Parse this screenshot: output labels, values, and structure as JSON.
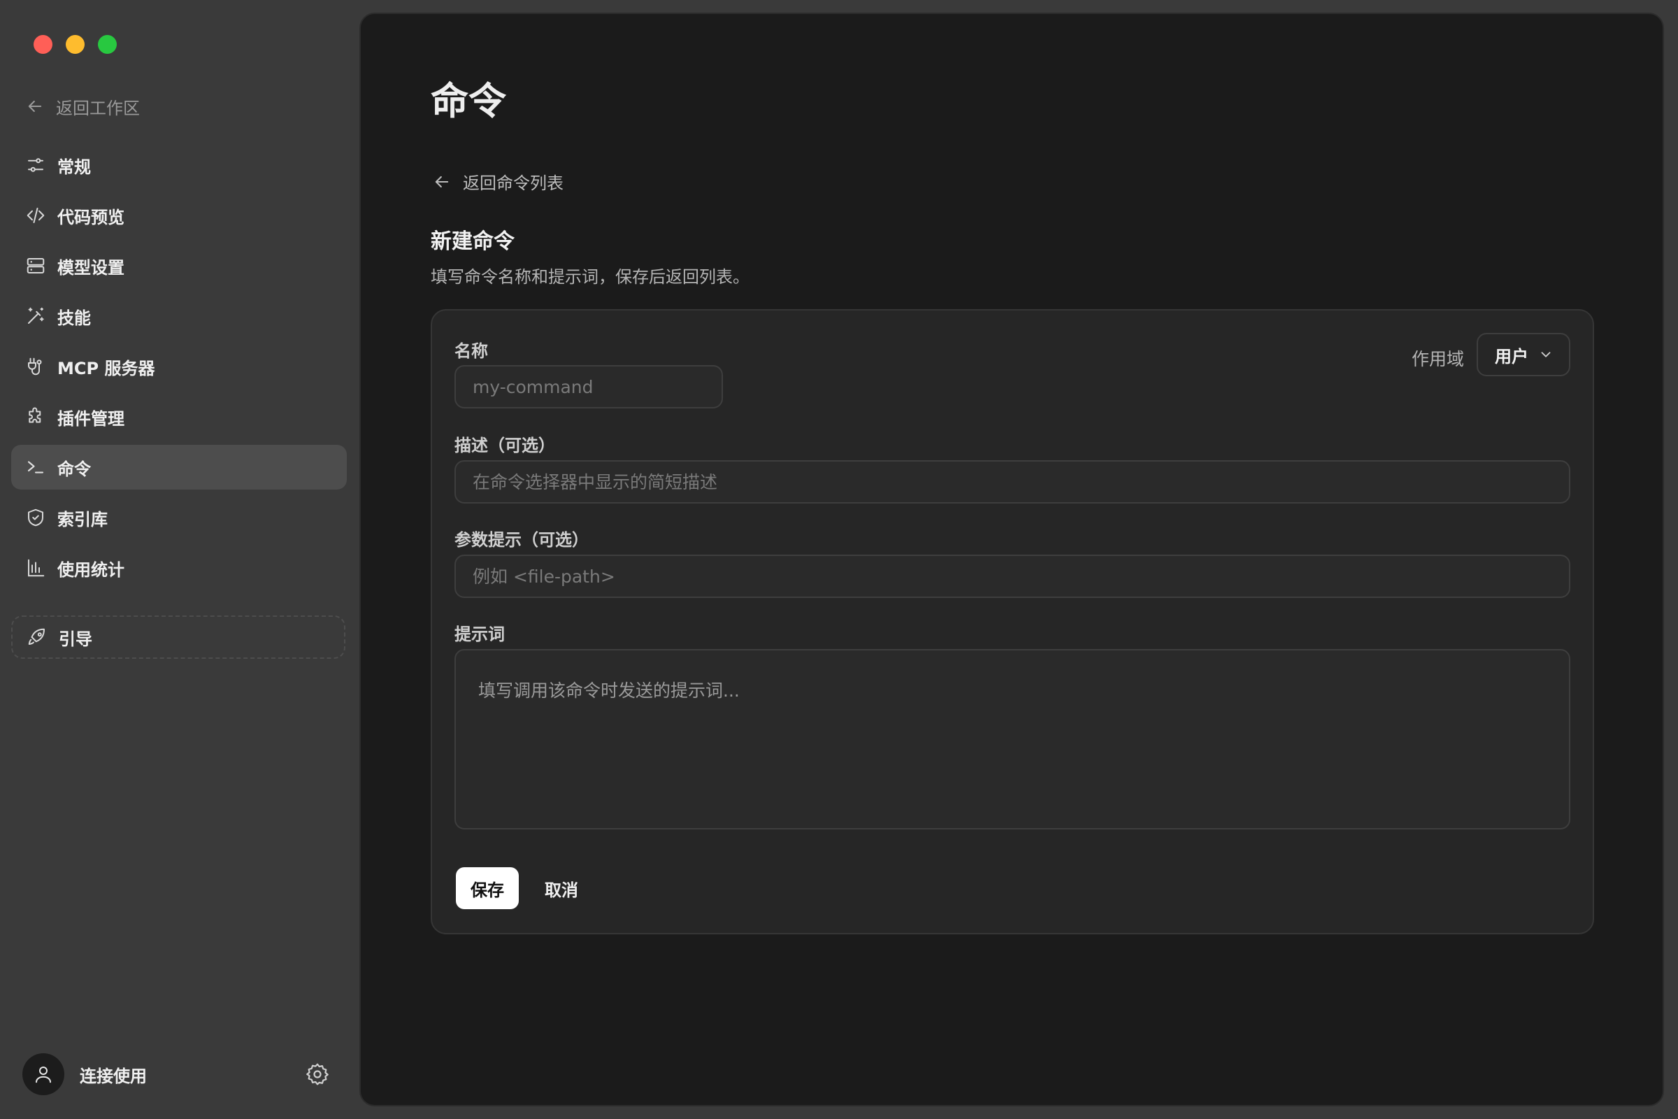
{
  "sidebar": {
    "back_to_workspace": "返回工作区",
    "items": [
      {
        "label": "常规",
        "icon": "sliders-icon"
      },
      {
        "label": "代码预览",
        "icon": "code-icon"
      },
      {
        "label": "模型设置",
        "icon": "server-icon"
      },
      {
        "label": "技能",
        "icon": "magic-wand-icon"
      },
      {
        "label": "MCP 服务器",
        "icon": "plug-icon"
      },
      {
        "label": "插件管理",
        "icon": "puzzle-icon"
      },
      {
        "label": "命令",
        "icon": "terminal-icon",
        "active": true
      },
      {
        "label": "索引库",
        "icon": "shield-icon"
      },
      {
        "label": "使用统计",
        "icon": "bar-chart-icon"
      }
    ],
    "guide_label": "引导",
    "user_label": "连接使用"
  },
  "main": {
    "title": "命令",
    "back_to_list": "返回命令列表",
    "form_title": "新建命令",
    "form_subtitle": "填写命令名称和提示词，保存后返回列表。",
    "fields": {
      "name_label": "名称",
      "name_placeholder": "my-command",
      "desc_label": "描述（可选）",
      "desc_placeholder": "在命令选择器中显示的简短描述",
      "args_label": "参数提示（可选）",
      "args_placeholder": "例如 <file-path>",
      "prompt_label": "提示词",
      "prompt_placeholder": "填写调用该命令时发送的提示词..."
    },
    "scope": {
      "label": "作用域",
      "value": "用户"
    },
    "save_label": "保存",
    "cancel_label": "取消"
  },
  "colors": {
    "sidebar_bg": "#3a3a3a",
    "main_bg": "#1b1b1b",
    "card_bg": "#262626",
    "active_item_bg": "#4d4d4d",
    "traffic_red": "#ff5f57",
    "traffic_yellow": "#febc2e",
    "traffic_green": "#28c840"
  }
}
